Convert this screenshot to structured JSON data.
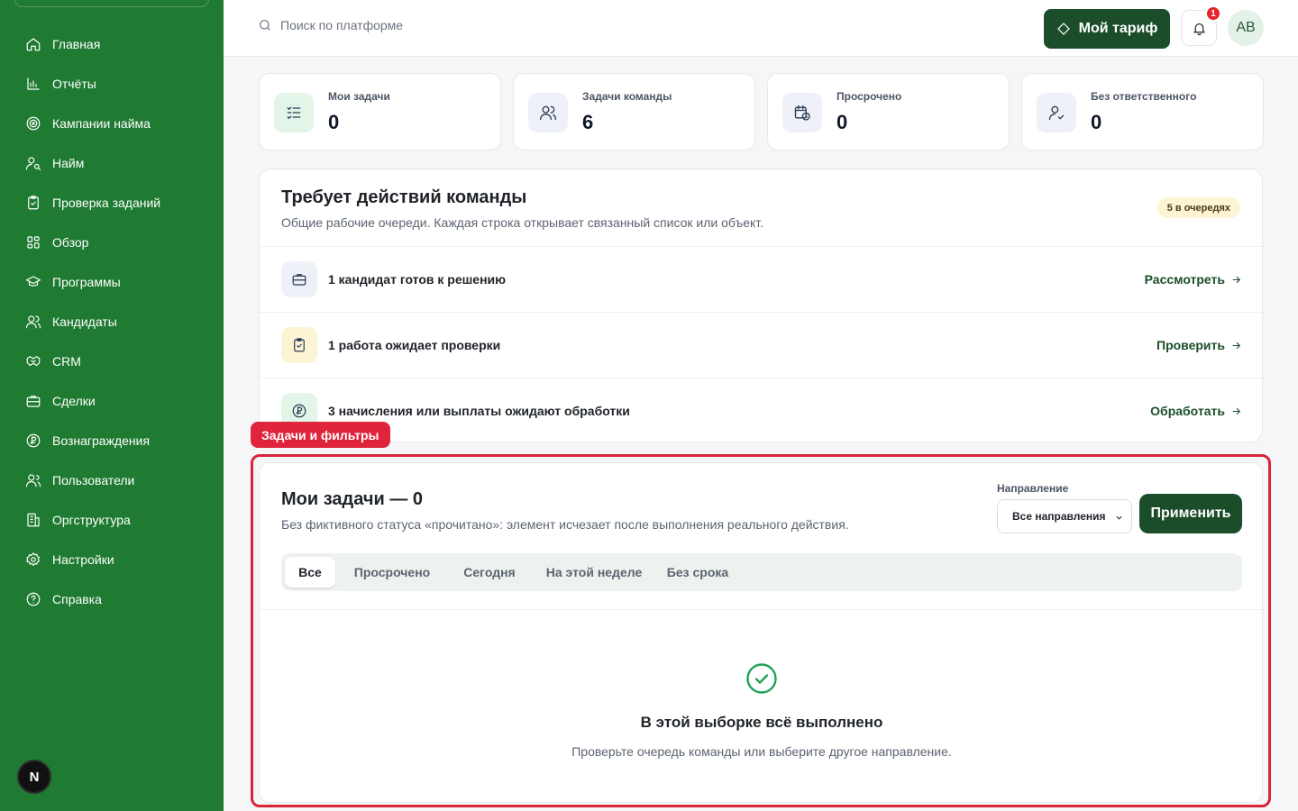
{
  "sidebar": {
    "items": [
      {
        "label": "Главная",
        "icon": "home-icon"
      },
      {
        "label": "Отчёты",
        "icon": "bar-chart-icon"
      },
      {
        "label": "Кампании найма",
        "icon": "target-icon"
      },
      {
        "label": "Найм",
        "icon": "user-search-icon"
      },
      {
        "label": "Проверка заданий",
        "icon": "clipboard-check-icon"
      },
      {
        "label": "Обзор",
        "icon": "grid-icon"
      },
      {
        "label": "Программы",
        "icon": "graduation-cap-icon"
      },
      {
        "label": "Кандидаты",
        "icon": "users-icon"
      },
      {
        "label": "CRM",
        "icon": "handshake-icon"
      },
      {
        "label": "Сделки",
        "icon": "briefcase-icon"
      },
      {
        "label": "Вознаграждения",
        "icon": "coin-icon"
      },
      {
        "label": "Пользователи",
        "icon": "user-group-icon"
      },
      {
        "label": "Оргструктура",
        "icon": "building-icon"
      },
      {
        "label": "Настройки",
        "icon": "gear-icon"
      },
      {
        "label": "Справка",
        "icon": "help-circle-icon"
      }
    ],
    "bottom_badge": "N"
  },
  "topbar": {
    "search_placeholder": "Поиск по платформе",
    "plan_button": "Мой тариф",
    "notification_count": "1",
    "avatar_initials": "AB"
  },
  "stats": [
    {
      "label": "Мои задачи",
      "value": "0",
      "icon": "list-check-icon",
      "bg": "#e3f5e8"
    },
    {
      "label": "Задачи команды",
      "value": "6",
      "icon": "users-icon",
      "bg": "#eef1f8"
    },
    {
      "label": "Просрочено",
      "value": "0",
      "icon": "calendar-clock-icon",
      "bg": "#eef1f8"
    },
    {
      "label": "Без ответственного",
      "value": "0",
      "icon": "user-check-icon",
      "bg": "#eef1f8"
    }
  ],
  "team": {
    "title": "Требует действий команды",
    "subtitle": "Общие рабочие очереди. Каждая строка открывает связанный список или объект.",
    "queue_badge": "5 в очередях",
    "rows": [
      {
        "text": "1 кандидат готов к решению",
        "action": "Рассмотреть",
        "icon": "briefcase-icon",
        "bg": "#eef1f8"
      },
      {
        "text": "1 работа ожидает проверки",
        "action": "Проверить",
        "icon": "clipboard-check-icon",
        "bg": "#fdf4d4"
      },
      {
        "text": "3 начисления или выплаты ожидают обработки",
        "action": "Обработать",
        "icon": "coin-icon",
        "bg": "#e3f5e8"
      }
    ]
  },
  "highlight_label": "Задачи и фильтры",
  "tasks": {
    "title": "Мои задачи — 0",
    "subtitle": "Без фиктивного статуса «прочитано»: элемент исчезает после выполнения реального действия.",
    "direction_label": "Направление",
    "direction_value": "Все направления",
    "apply_button": "Применить",
    "tabs": [
      "Все",
      "Просрочено",
      "Сегодня",
      "На этой неделе",
      "Без срока"
    ],
    "active_tab": "Все",
    "empty_title": "В этой выборке всё выполнено",
    "empty_subtitle": "Проверьте очередь команды или выберите другое направление."
  }
}
